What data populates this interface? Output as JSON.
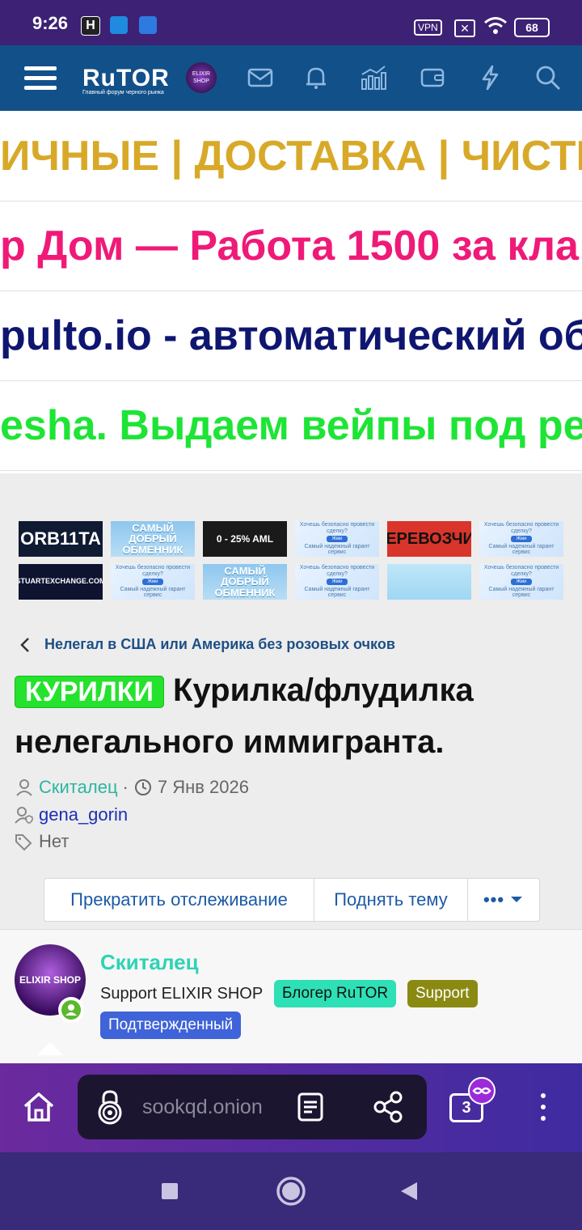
{
  "status_bar": {
    "time": "9:26",
    "vpn": "VPN",
    "battery": "68"
  },
  "header": {
    "logo_text": "RuTOR",
    "logo_tagline": "Главный форум черного рынка",
    "avatar_text": "ELIXIR SHOP"
  },
  "banners": [
    {
      "text": "ИЧНЫЕ | ДОСТАВКА | ЧИСТК",
      "color": "#d8a928"
    },
    {
      "text": "р Дом — Работа 1500 за кла",
      "color": "#ef1a78"
    },
    {
      "text": "pulto.io - автоматический об",
      "color": "#0f1670"
    },
    {
      "text": "esha. Выдаем вейпы под реа",
      "color": "#1ee436"
    }
  ],
  "ads": {
    "orbita": "ORB11TA",
    "dobry": "САМЫЙ ДОБРЫЙ ОБМЕННИК",
    "aml": "0 - 25% AML",
    "garant_title": "Хочешь безопасно провести сделку?",
    "garant_btn": "Жми",
    "garant_sub": "Самый надежный гарант сервис",
    "perevozchik": "ПЕРЕВОЗЧИК",
    "stuart": "STUARTEXCHANGE.COM"
  },
  "breadcrumb": "Нелегал в США или Америка без розовых очков",
  "thread": {
    "prefix": "КУРИЛКИ",
    "title_line1": "Курилка/флудилка",
    "title_line2": "нелегального иммигранта.",
    "author": "Скиталец",
    "date": "7 Янв 2026",
    "moderator": "gena_gorin",
    "tags": "Нет"
  },
  "actions": {
    "unwatch": "Прекратить отслеживание",
    "bump": "Поднять тему"
  },
  "post": {
    "username": "Скиталец",
    "user_title": "Support ELIXIR SHOP",
    "badges": [
      {
        "label": "Блогер RuTOR",
        "color": "#2ee0b5"
      },
      {
        "label": "Support",
        "color": "#8a8a12"
      },
      {
        "label": "Подтвержденный",
        "color": "#3f63d8"
      }
    ]
  },
  "browser": {
    "url": "sookqd.onion",
    "tabs_count": "3"
  }
}
